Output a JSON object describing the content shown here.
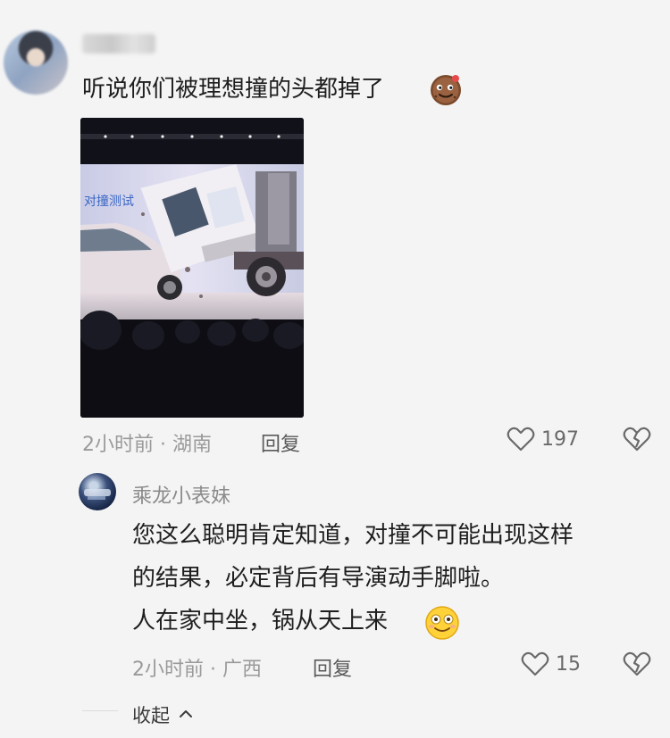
{
  "comment": {
    "text": "听说你们被理想撞的头都掉了",
    "meta_time": "2小时前 · 湖南",
    "reply_label": "回复",
    "like_count": "197",
    "image_caption": "对撞测试"
  },
  "reply": {
    "username": "乘龙小表妹",
    "line1": "您这么聪明肯定知道，对撞不可能出现这样",
    "line2": "的结果，必定背后有导演动手脚啦。",
    "line3": "人在家中坐，锅从天上来",
    "meta_time": "2小时前 · 广西",
    "reply_label": "回复",
    "like_count": "15"
  },
  "collapse_label": "收起",
  "icons": {
    "like": "heart-icon",
    "dislike": "broken-heart-icon",
    "collapse": "chevron-up-icon",
    "emoji_cookie": "cookie-face-emoji",
    "emoji_smile": "smiling-face-emoji"
  }
}
